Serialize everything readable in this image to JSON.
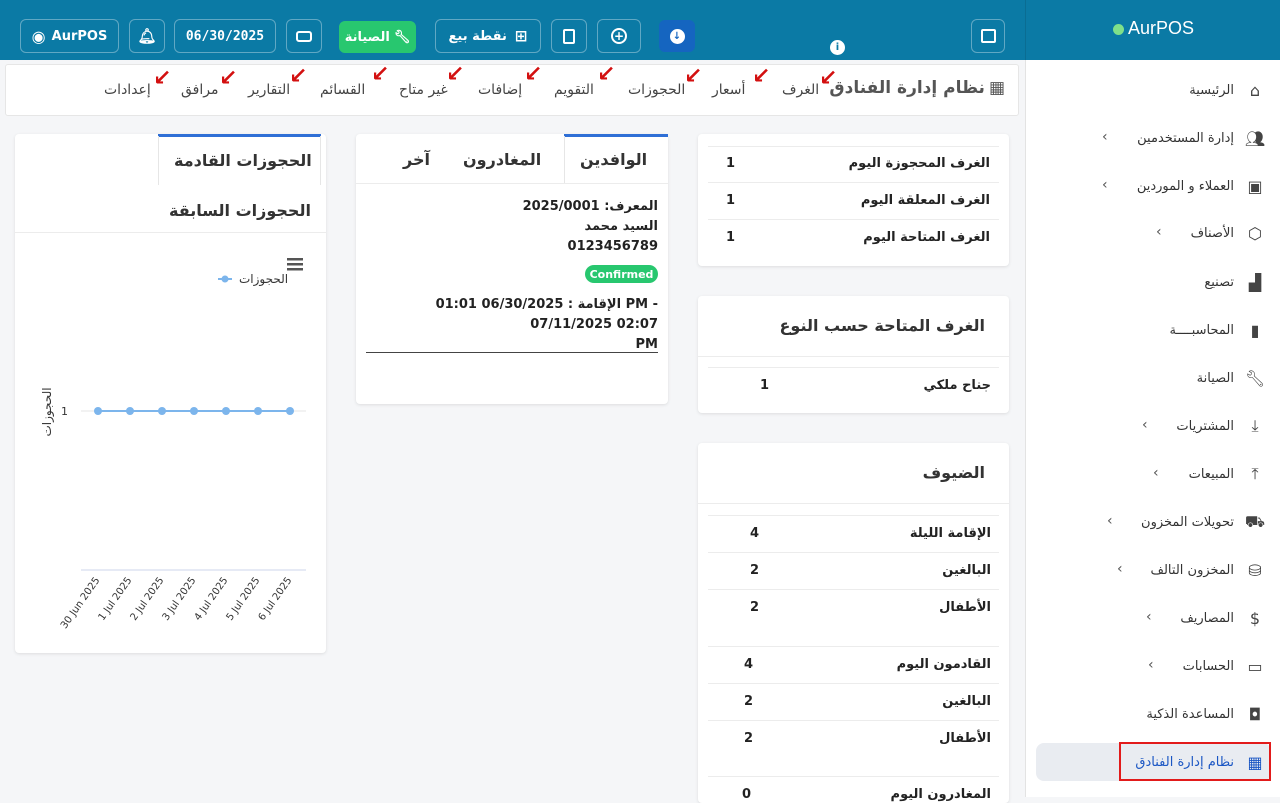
{
  "brand": {
    "name": "AurPOS"
  },
  "topbar": {
    "user_label": "AurPOS",
    "date": "06/30/2025",
    "maintenance_label": "الصيانة",
    "pos_label": "نقطة بيع"
  },
  "sidebar": {
    "items": [
      {
        "label": "الرئيسية"
      },
      {
        "label": "إدارة المستخدمين"
      },
      {
        "label": "العملاء و الموردين"
      },
      {
        "label": "الأصناف"
      },
      {
        "label": "تصنيع"
      },
      {
        "label": "المحاسبــــة"
      },
      {
        "label": "الصيانة"
      },
      {
        "label": "المشتريات"
      },
      {
        "label": "المبيعات"
      },
      {
        "label": "تحويلات المخزون"
      },
      {
        "label": "المخزون التالف"
      },
      {
        "label": "المصاريف"
      },
      {
        "label": "الحسابات"
      },
      {
        "label": "المساعدة الذكية"
      },
      {
        "label": "نظام إدارة الفنادق"
      }
    ]
  },
  "hotel_nav": {
    "title": "نظام إدارة الفنادق",
    "items": [
      "الغرف",
      "أسعار",
      "الحجوزات",
      "التقويم",
      "إضافات",
      "غير متاح",
      "القسائم",
      "التقارير",
      "مرافق",
      "إعدادات"
    ]
  },
  "rooms_today": {
    "rows": [
      {
        "label": "الغرف المحجوزة اليوم",
        "value": "1"
      },
      {
        "label": "الغرف المعلقة اليوم",
        "value": "1"
      },
      {
        "label": "الغرف المتاحة اليوم",
        "value": "1"
      }
    ]
  },
  "available_by_type": {
    "title": "الغرف المتاحة حسب النوع",
    "rows": [
      {
        "label": "جناح ملكي",
        "value": "1"
      }
    ]
  },
  "guests": {
    "title": "الضيوف",
    "rows": [
      {
        "label": "الإقامة الليلة",
        "value": "4"
      },
      {
        "label": "البالغين",
        "value": "2"
      },
      {
        "label": "الأطفال",
        "value": "2"
      },
      {
        "label": "القادمون اليوم",
        "value": "4"
      },
      {
        "label": "البالغين",
        "value": "2"
      },
      {
        "label": "الأطفال",
        "value": "2"
      },
      {
        "label": "المغادرون اليوم",
        "value": "0"
      }
    ]
  },
  "arrivals": {
    "tabs": [
      "الوافدين",
      "المغادرون",
      "آخر"
    ],
    "booking_id": "المعرف: 2025/0001",
    "guest_name": "السيد محمد",
    "phone": "0123456789",
    "status": "Confirmed",
    "stay_line1": "الإقامة : 06/30/2025 01:01 PM - 07/11/2025 02:07",
    "stay_line2": "PM"
  },
  "bookings": {
    "tab_upcoming": "الحجوزات القادمة",
    "tab_past": "الحجوزات السابقة"
  },
  "chart_data": {
    "type": "line",
    "categories": [
      "30 Jun 2025",
      "1 Jul 2025",
      "2 Jul 2025",
      "3 Jul 2025",
      "4 Jul 2025",
      "5 Jul 2025",
      "6 Jul 2025"
    ],
    "series": [
      {
        "name": "الحجوزات",
        "values": [
          1,
          1,
          1,
          1,
          1,
          1,
          1
        ]
      }
    ],
    "ylabel": "الحجوزات",
    "yticks": [
      "1"
    ],
    "legend": "top-right",
    "color": "#7cb5ec"
  },
  "colors": {
    "primary": "#0b7aa5",
    "success": "#28c76f",
    "highlight": "#e21b1b"
  }
}
